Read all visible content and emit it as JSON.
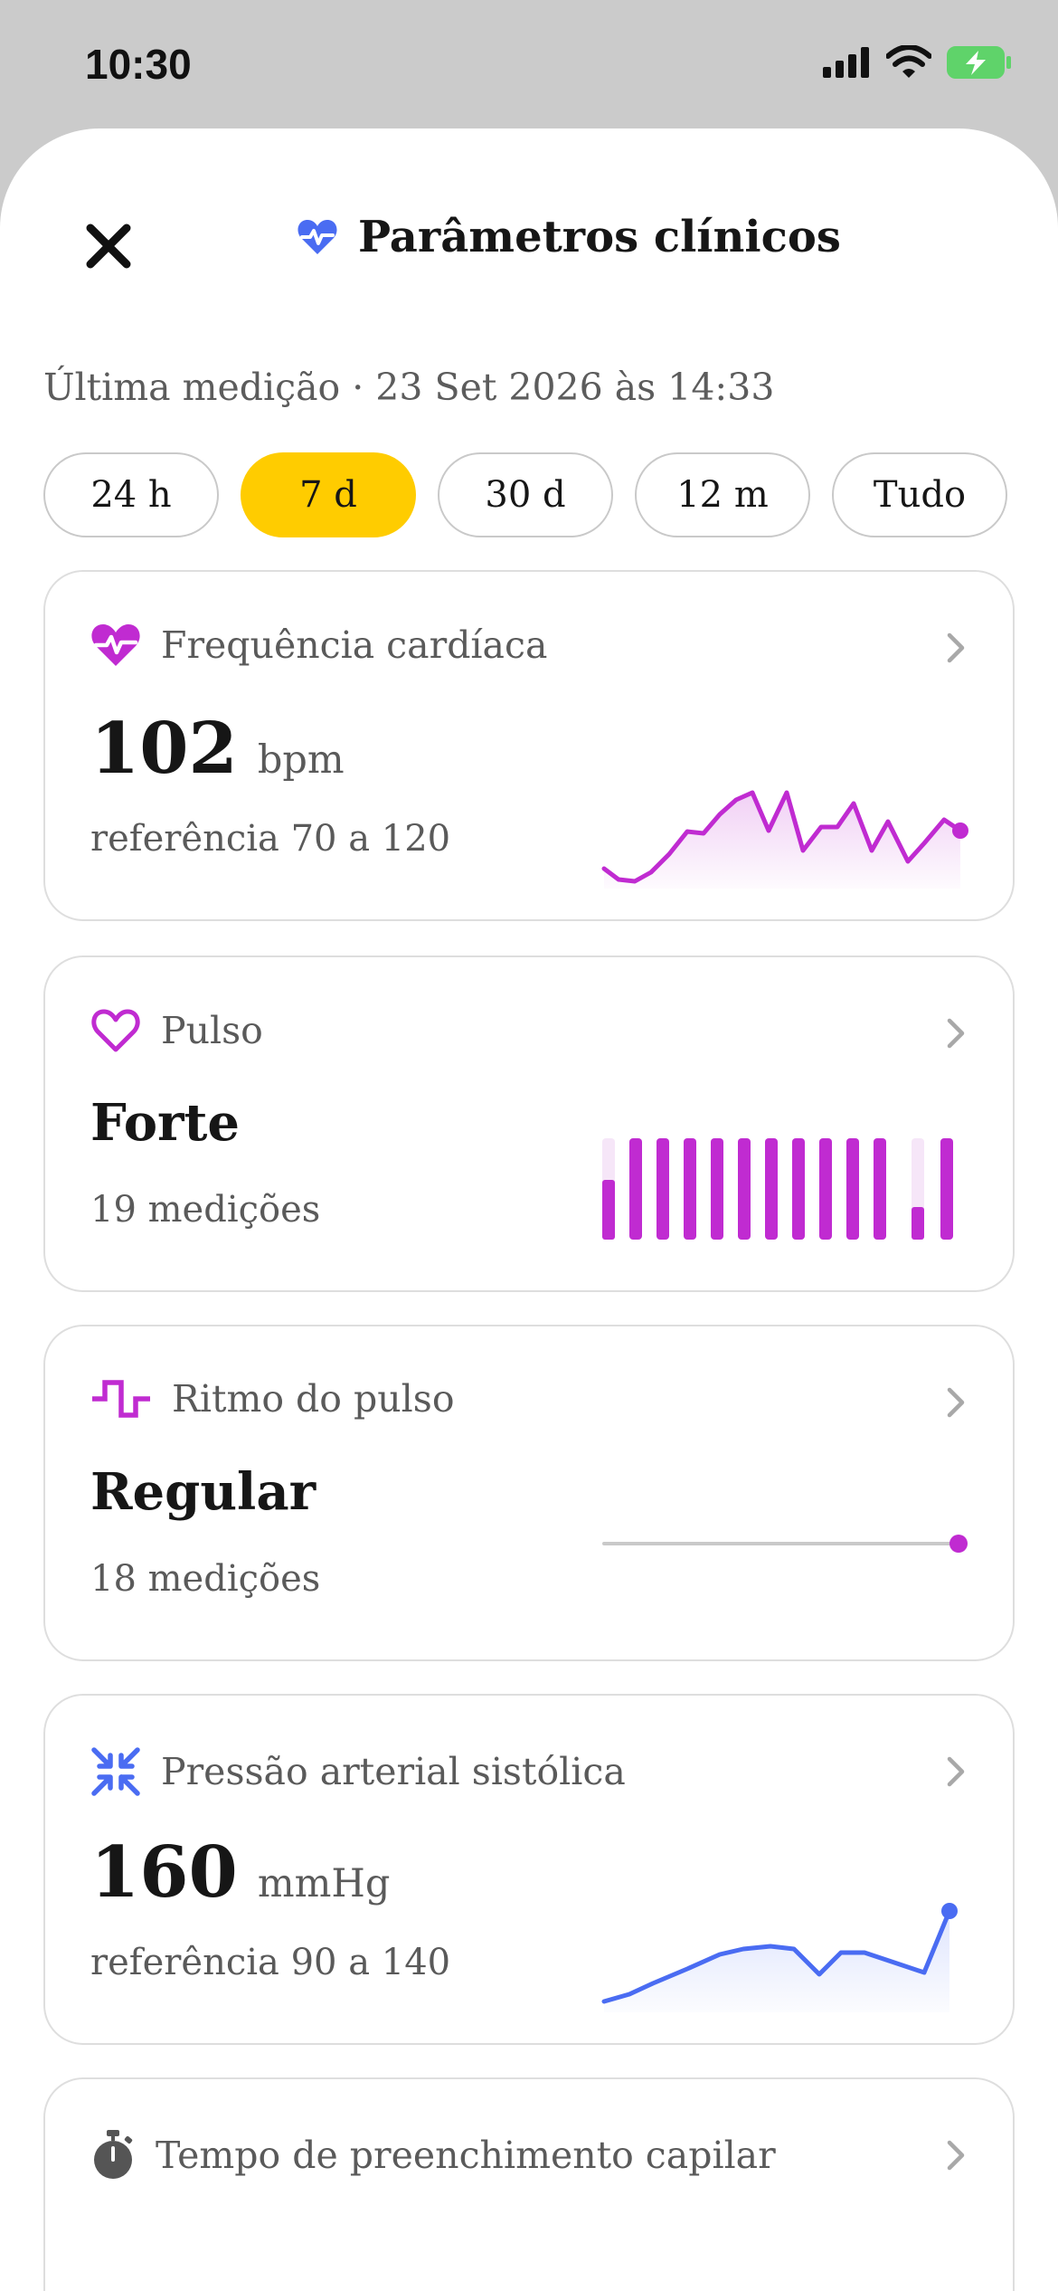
{
  "status_bar": {
    "time": "10:30"
  },
  "header": {
    "title": "Parâmetros clínicos"
  },
  "last_measurement": "Última medição · 23 Set 2026 às 14:33",
  "filters": [
    {
      "label": "24 h"
    },
    {
      "label": "7 d"
    },
    {
      "label": "30 d"
    },
    {
      "label": "12 m"
    },
    {
      "label": "Tudo"
    }
  ],
  "selected_filter": "7 d",
  "colors": {
    "accent": "#ffcc00",
    "purple": "#c02bd1",
    "blue": "#4a6cf2",
    "line_gray": "#c9c9c9"
  },
  "cards": {
    "heart_rate": {
      "label": "Frequência cardíaca",
      "value": "102",
      "unit": "bpm",
      "reference": "referência 70 a 120",
      "icon": "heart-pulse-icon"
    },
    "pulse": {
      "label": "Pulso",
      "value": "Forte",
      "count": "19 medições",
      "icon": "heart-outline-icon"
    },
    "pulse_rhythm": {
      "label": "Ritmo do pulso",
      "value": "Regular",
      "count": "18 medições",
      "icon": "rhythm-icon"
    },
    "systolic": {
      "label": "Pressão arterial sistólica",
      "value": "160",
      "unit": "mmHg",
      "reference": "referência 90 a 140",
      "icon": "compress-icon"
    },
    "capillary": {
      "label": "Tempo de preenchimento capilar",
      "icon": "stopwatch-icon"
    }
  }
}
